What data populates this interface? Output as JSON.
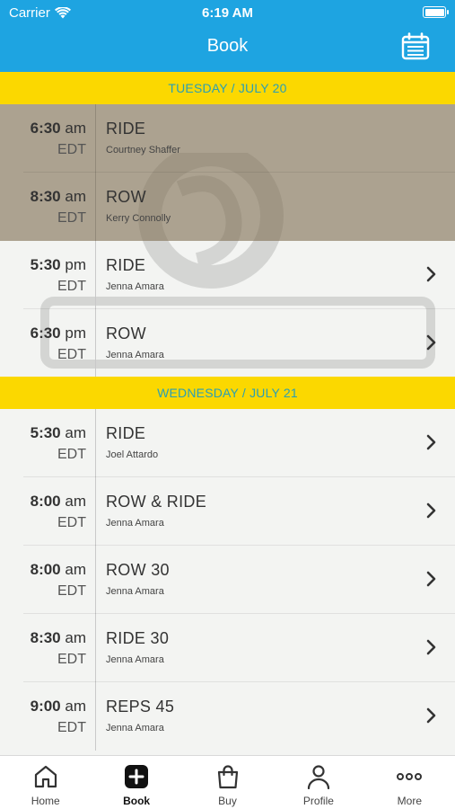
{
  "status_bar": {
    "carrier": "Carrier",
    "time": "6:19 AM"
  },
  "header": {
    "title": "Book"
  },
  "days": [
    {
      "label": "TUESDAY / JULY 20",
      "classes": [
        {
          "time": "6:30",
          "ampm": "am",
          "tz": "EDT",
          "name": "RIDE",
          "instructor": "Courtney Shaffer",
          "past": true
        },
        {
          "time": "8:30",
          "ampm": "am",
          "tz": "EDT",
          "name": "ROW",
          "instructor": "Kerry Connolly",
          "past": true
        },
        {
          "time": "5:30",
          "ampm": "pm",
          "tz": "EDT",
          "name": "RIDE",
          "instructor": "Jenna Amara",
          "past": false
        },
        {
          "time": "6:30",
          "ampm": "pm",
          "tz": "EDT",
          "name": "ROW",
          "instructor": "Jenna Amara",
          "past": false
        }
      ]
    },
    {
      "label": "WEDNESDAY / JULY 21",
      "classes": [
        {
          "time": "5:30",
          "ampm": "am",
          "tz": "EDT",
          "name": "RIDE",
          "instructor": "Joel Attardo",
          "past": false
        },
        {
          "time": "8:00",
          "ampm": "am",
          "tz": "EDT",
          "name": "ROW & RIDE",
          "instructor": "Jenna Amara",
          "past": false
        },
        {
          "time": "8:00",
          "ampm": "am",
          "tz": "EDT",
          "name": "ROW 30",
          "instructor": "Jenna Amara",
          "past": false
        },
        {
          "time": "8:30",
          "ampm": "am",
          "tz": "EDT",
          "name": "RIDE 30",
          "instructor": "Jenna Amara",
          "past": false
        },
        {
          "time": "9:00",
          "ampm": "am",
          "tz": "EDT",
          "name": "REPS 45",
          "instructor": "Jenna Amara",
          "past": false
        }
      ]
    }
  ],
  "tabs": [
    {
      "label": "Home",
      "icon": "home-icon",
      "active": false
    },
    {
      "label": "Book",
      "icon": "plus-square-icon",
      "active": true
    },
    {
      "label": "Buy",
      "icon": "shopping-bag-icon",
      "active": false
    },
    {
      "label": "Profile",
      "icon": "person-icon",
      "active": false
    },
    {
      "label": "More",
      "icon": "more-dots-icon",
      "active": false
    }
  ],
  "colors": {
    "header": "#1ea4e1",
    "banner": "#fbd800",
    "banner_text": "#2a9fb4"
  }
}
